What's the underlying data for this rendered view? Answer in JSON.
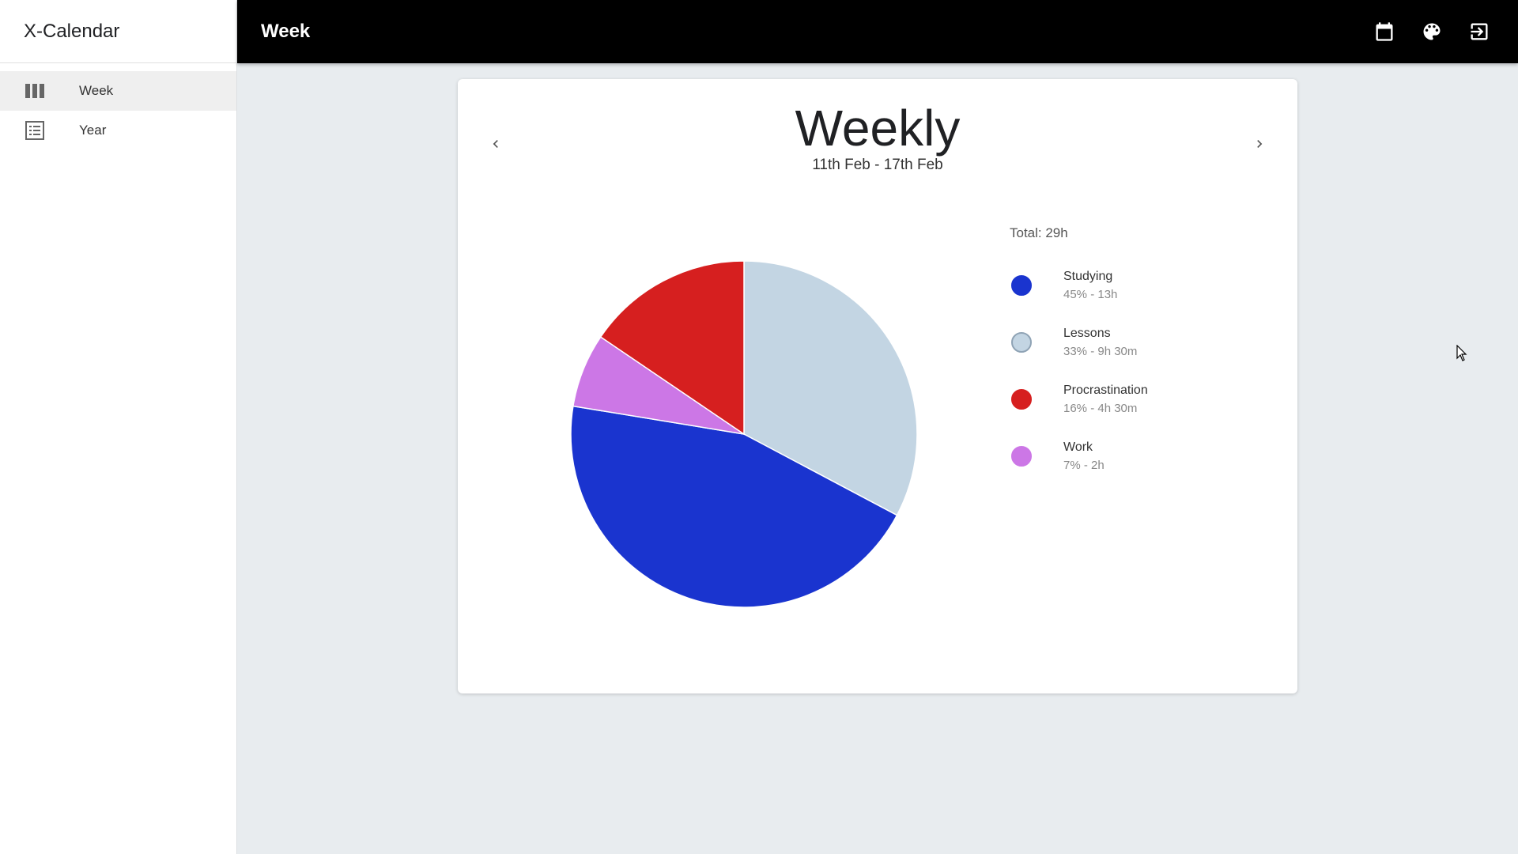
{
  "app": {
    "name": "X-Calendar"
  },
  "sidebar": {
    "items": [
      {
        "label": "Week",
        "icon": "view-week-icon",
        "active": true
      },
      {
        "label": "Year",
        "icon": "list-icon",
        "active": false
      }
    ]
  },
  "topbar": {
    "title": "Week",
    "icons": [
      "calendar-icon",
      "palette-icon",
      "logout-icon"
    ]
  },
  "card": {
    "heading": "Weekly",
    "date_range": "11th Feb - 17th Feb",
    "total": "Total: 29h",
    "legend": [
      {
        "name": "Studying",
        "detail": "45% - 13h",
        "color": "#1a34cf"
      },
      {
        "name": "Lessons",
        "detail": "33% - 9h 30m",
        "color": "#c3d5e3"
      },
      {
        "name": "Procrastination",
        "detail": "16% - 4h 30m",
        "color": "#d61f1f"
      },
      {
        "name": "Work",
        "detail": "7% - 2h",
        "color": "#cc77e6"
      }
    ]
  },
  "chart_data": {
    "type": "pie",
    "categories": [
      "Lessons",
      "Studying",
      "Work",
      "Procrastination"
    ],
    "values": [
      9.5,
      13,
      2,
      4.5
    ],
    "colors": [
      "#c3d5e3",
      "#1a34cf",
      "#cc77e6",
      "#d61f1f"
    ]
  }
}
